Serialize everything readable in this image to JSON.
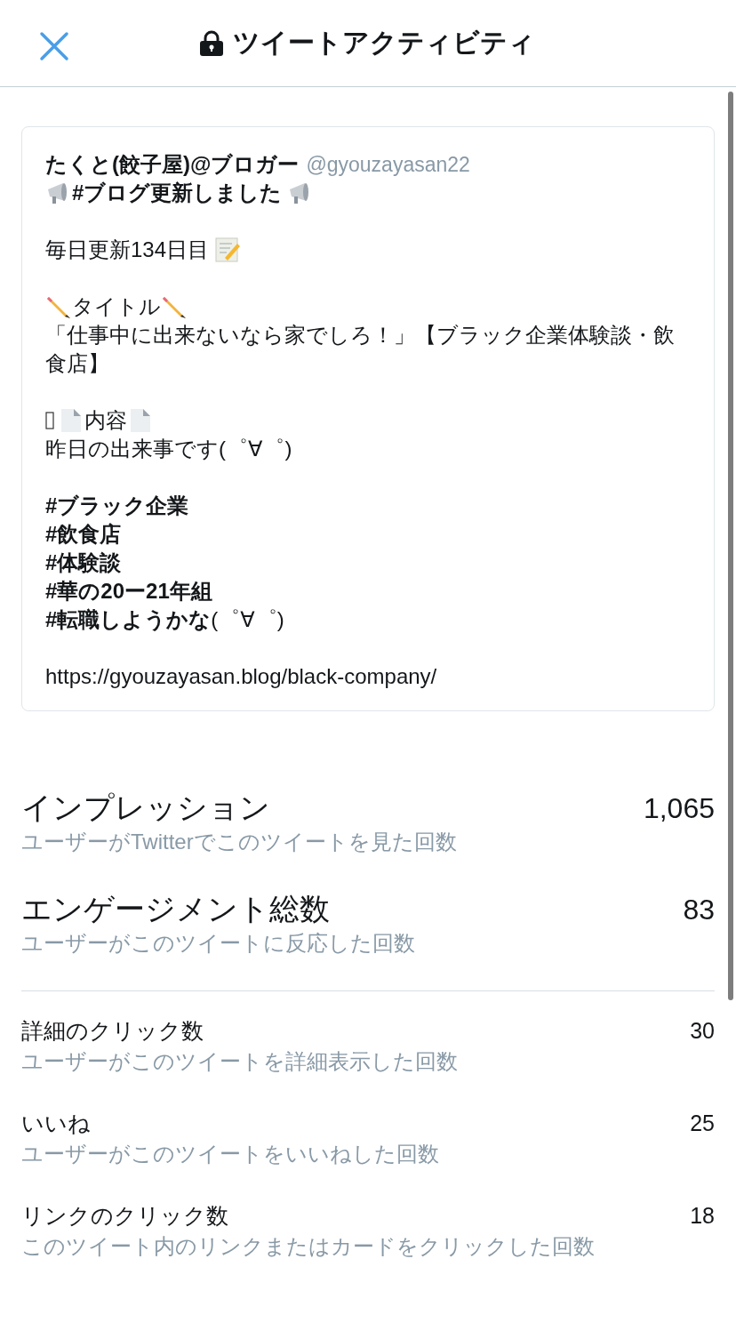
{
  "header": {
    "title": "ツイートアクティビティ"
  },
  "tweet": {
    "author": "たくと(餃子屋)@ブロガー",
    "handle": "@gyouzayasan22",
    "headline": "#ブログ更新しました",
    "day_line": "毎日更新134日目",
    "title_label": "タイトル",
    "title_text": "「仕事中に出来ないなら家でしろ！」【ブラック企業体験談・飲食店】",
    "content_label": "内容",
    "content_text": "昨日の出来事です(゜∀゜)",
    "hashtags": [
      "**#ブラック企業**",
      "**#飲食店**",
      "**#体験談**",
      "**#華の20ー21年組**",
      "**#転職しようかな**(゜∀゜)"
    ],
    "url": "https://gyouzayasan.blog/black-company/"
  },
  "metrics": [
    {
      "kind": "major",
      "label": "インプレッション",
      "value": "1,065",
      "description": "ユーザーがTwitterでこのツイートを見た回数"
    },
    {
      "kind": "major",
      "label": "エンゲージメント総数",
      "value": "83",
      "description": "ユーザーがこのツイートに反応した回数"
    },
    {
      "kind": "minor",
      "label": "詳細のクリック数",
      "value": "30",
      "description": "ユーザーがこのツイートを詳細表示した回数"
    },
    {
      "kind": "minor",
      "label": "いいね",
      "value": "25",
      "description": "ユーザーがこのツイートをいいねした回数"
    },
    {
      "kind": "minor",
      "label": "リンクのクリック数",
      "value": "18",
      "description": "このツイート内のリンクまたはカードをクリックした回数"
    }
  ]
}
